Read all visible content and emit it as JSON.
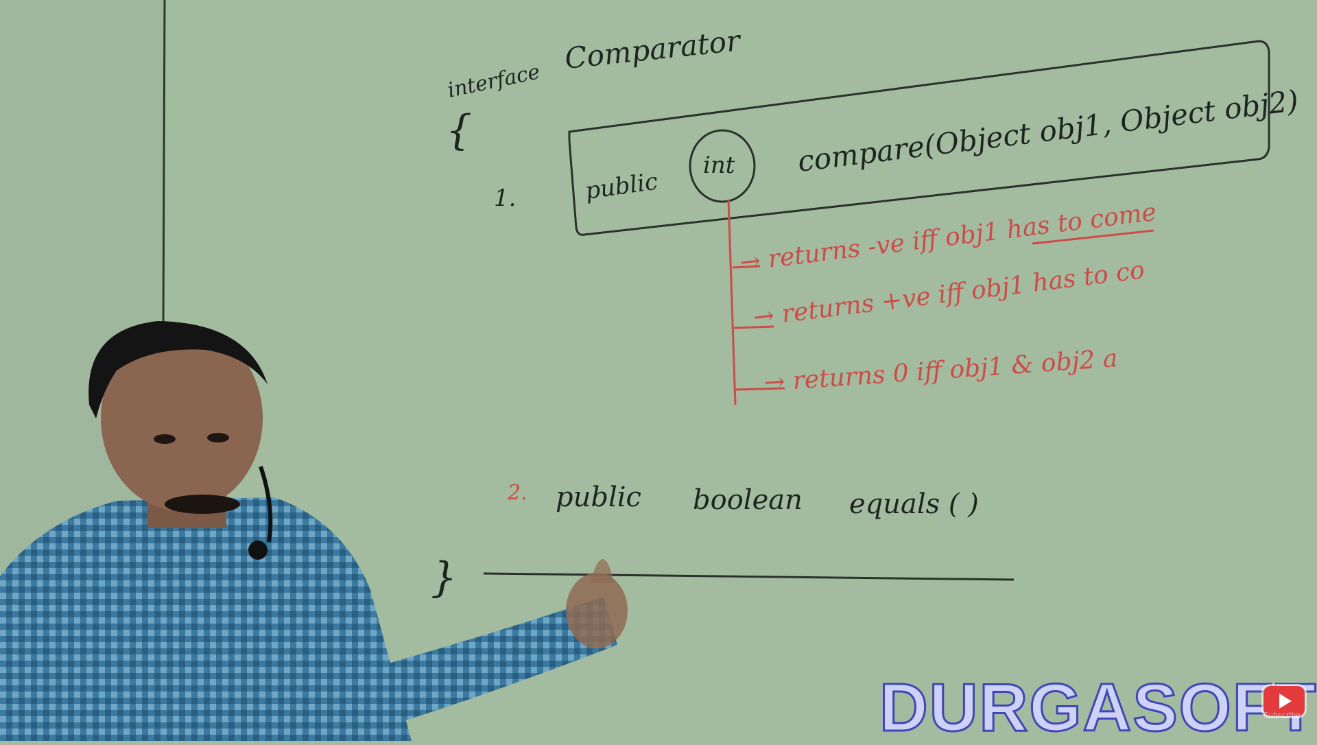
{
  "board": {
    "title": {
      "kw": "interface",
      "name": "Comparator"
    },
    "open_brace": "{",
    "close_brace": "}",
    "method1": {
      "num": "1.",
      "mod": "public",
      "ret": "int",
      "sig": "compare(Object obj1, Object obj2)"
    },
    "returns": [
      "→ returns -ve iff obj1 has to come",
      "→ returns +ve iff obj1 has to co",
      "→ returns 0 iff obj1 & obj2 a"
    ],
    "method2": {
      "num": "2.",
      "mod": "public",
      "ret": "boolean",
      "name": "equals ( )"
    }
  },
  "watermark": {
    "text": "DURGASOFT"
  },
  "subscribe": {
    "label": "Subscribe"
  },
  "colors": {
    "board": "#a3bb9f",
    "ink_black": "#1e2420",
    "ink_red": "#cf4b47",
    "logo_fill": "#cfd2f7",
    "logo_stroke": "#3f47b8",
    "shirt": "#3a7aa0"
  }
}
